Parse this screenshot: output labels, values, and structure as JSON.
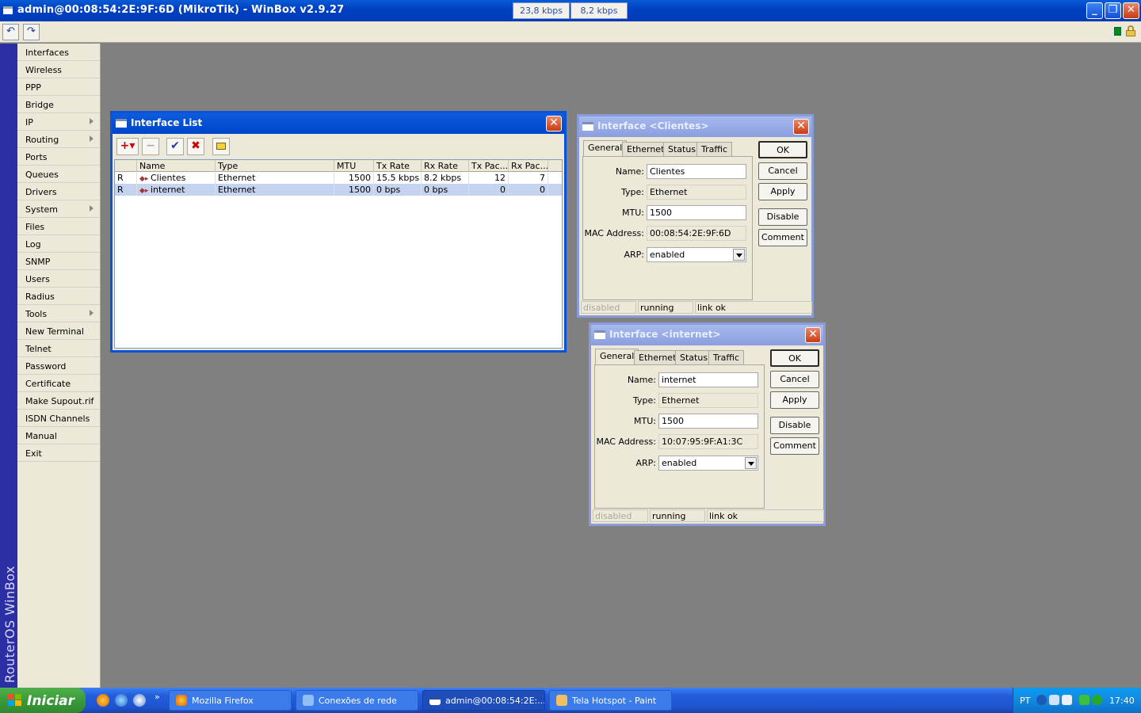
{
  "window": {
    "title": "admin@00:08:54:2E:9F:6D (MikroTik) - WinBox v2.9.27",
    "tx_rate": "23,8 kbps",
    "rx_rate": "8,2 kbps"
  },
  "toolbar": {
    "undo_icon": "undo-icon",
    "redo_icon": "redo-icon"
  },
  "sidebar": {
    "brand": "RouterOS WinBox",
    "items": [
      {
        "label": "Interfaces",
        "submenu": false
      },
      {
        "label": "Wireless",
        "submenu": false
      },
      {
        "label": "PPP",
        "submenu": false
      },
      {
        "label": "Bridge",
        "submenu": false
      },
      {
        "label": "IP",
        "submenu": true
      },
      {
        "label": "Routing",
        "submenu": true
      },
      {
        "label": "Ports",
        "submenu": false
      },
      {
        "label": "Queues",
        "submenu": false
      },
      {
        "label": "Drivers",
        "submenu": false
      },
      {
        "label": "System",
        "submenu": true
      },
      {
        "label": "Files",
        "submenu": false
      },
      {
        "label": "Log",
        "submenu": false
      },
      {
        "label": "SNMP",
        "submenu": false
      },
      {
        "label": "Users",
        "submenu": false
      },
      {
        "label": "Radius",
        "submenu": false
      },
      {
        "label": "Tools",
        "submenu": true
      },
      {
        "label": "New Terminal",
        "submenu": false
      },
      {
        "label": "Telnet",
        "submenu": false
      },
      {
        "label": "Password",
        "submenu": false
      },
      {
        "label": "Certificate",
        "submenu": false
      },
      {
        "label": "Make Supout.rif",
        "submenu": false
      },
      {
        "label": "ISDN Channels",
        "submenu": false
      },
      {
        "label": "Manual",
        "submenu": false
      },
      {
        "label": "Exit",
        "submenu": false
      }
    ]
  },
  "interface_list": {
    "title": "Interface List",
    "columns": [
      "Name",
      "Type",
      "MTU",
      "Tx Rate",
      "Rx Rate",
      "Tx Pac...",
      "Rx Pac..."
    ],
    "rows": [
      {
        "flag": "R",
        "name": "Clientes",
        "type": "Ethernet",
        "mtu": "1500",
        "tx_rate": "15.5 kbps",
        "rx_rate": "8.2 kbps",
        "tx_packets": "12",
        "rx_packets": "7",
        "selected": false
      },
      {
        "flag": "R",
        "name": "internet",
        "type": "Ethernet",
        "mtu": "1500",
        "tx_rate": "0 bps",
        "rx_rate": "0 bps",
        "tx_packets": "0",
        "rx_packets": "0",
        "selected": true
      }
    ]
  },
  "dialog_clientes": {
    "title": "Interface <Clientes>",
    "tabs": [
      "General",
      "Ethernet",
      "Status",
      "Traffic"
    ],
    "labels": {
      "name": "Name:",
      "type": "Type:",
      "mtu": "MTU:",
      "mac": "MAC Address:",
      "arp": "ARP:"
    },
    "values": {
      "name": "Clientes",
      "type": "Ethernet",
      "mtu": "1500",
      "mac": "00:08:54:2E:9F:6D",
      "arp": "enabled"
    },
    "buttons": {
      "ok": "OK",
      "cancel": "Cancel",
      "apply": "Apply",
      "disable": "Disable",
      "comment": "Comment"
    },
    "status": [
      "disabled",
      "running",
      "link ok"
    ]
  },
  "dialog_internet": {
    "title": "Interface <internet>",
    "tabs": [
      "General",
      "Ethernet",
      "Status",
      "Traffic"
    ],
    "labels": {
      "name": "Name:",
      "type": "Type:",
      "mtu": "MTU:",
      "mac": "MAC Address:",
      "arp": "ARP:"
    },
    "values": {
      "name": "internet",
      "type": "Ethernet",
      "mtu": "1500",
      "mac": "10:07:95:9F:A1:3C",
      "arp": "enabled"
    },
    "buttons": {
      "ok": "OK",
      "cancel": "Cancel",
      "apply": "Apply",
      "disable": "Disable",
      "comment": "Comment"
    },
    "status": [
      "disabled",
      "running",
      "link ok"
    ]
  },
  "taskbar": {
    "start_label": "Iniciar",
    "more": "»",
    "tasks": [
      {
        "label": "Mozilla Firefox",
        "active": false
      },
      {
        "label": "Conexões de rede",
        "active": false
      },
      {
        "label": "admin@00:08:54:2E:...",
        "active": true
      },
      {
        "label": "Tela Hotspot - Paint",
        "active": false
      }
    ],
    "lang": "PT",
    "clock": "17:40"
  }
}
